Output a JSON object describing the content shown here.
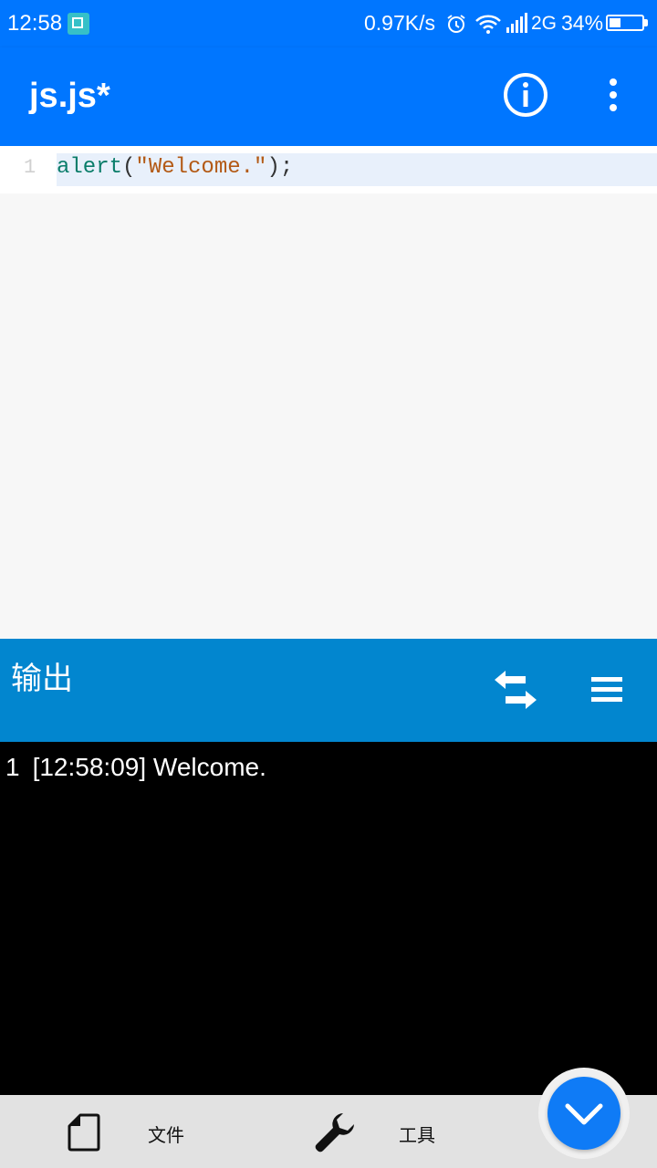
{
  "status_bar": {
    "time": "12:58",
    "net_speed": "0.97K/s",
    "network": "2G",
    "battery": "34%",
    "battery_level": 0.34
  },
  "app_bar": {
    "title": "js.js*",
    "info_icon": "info-icon",
    "more_icon": "more-vert-icon"
  },
  "editor": {
    "lines": [
      {
        "number": "1",
        "fn": "alert",
        "open": "(",
        "string": "\"Welcome.\"",
        "close": ");"
      }
    ]
  },
  "output": {
    "title": "输出",
    "swap_icon": "swap-arrows-icon",
    "menu_icon": "menu-icon",
    "lines": [
      {
        "number": "1",
        "text": "[12:58:09] Welcome."
      }
    ]
  },
  "bottom_nav": {
    "file_label": "文件",
    "tools_label": "工具"
  },
  "colors": {
    "primary": "#0076ff",
    "output_bar": "#0286cf",
    "console_bg": "#000000",
    "fab": "#0f7bf6"
  }
}
